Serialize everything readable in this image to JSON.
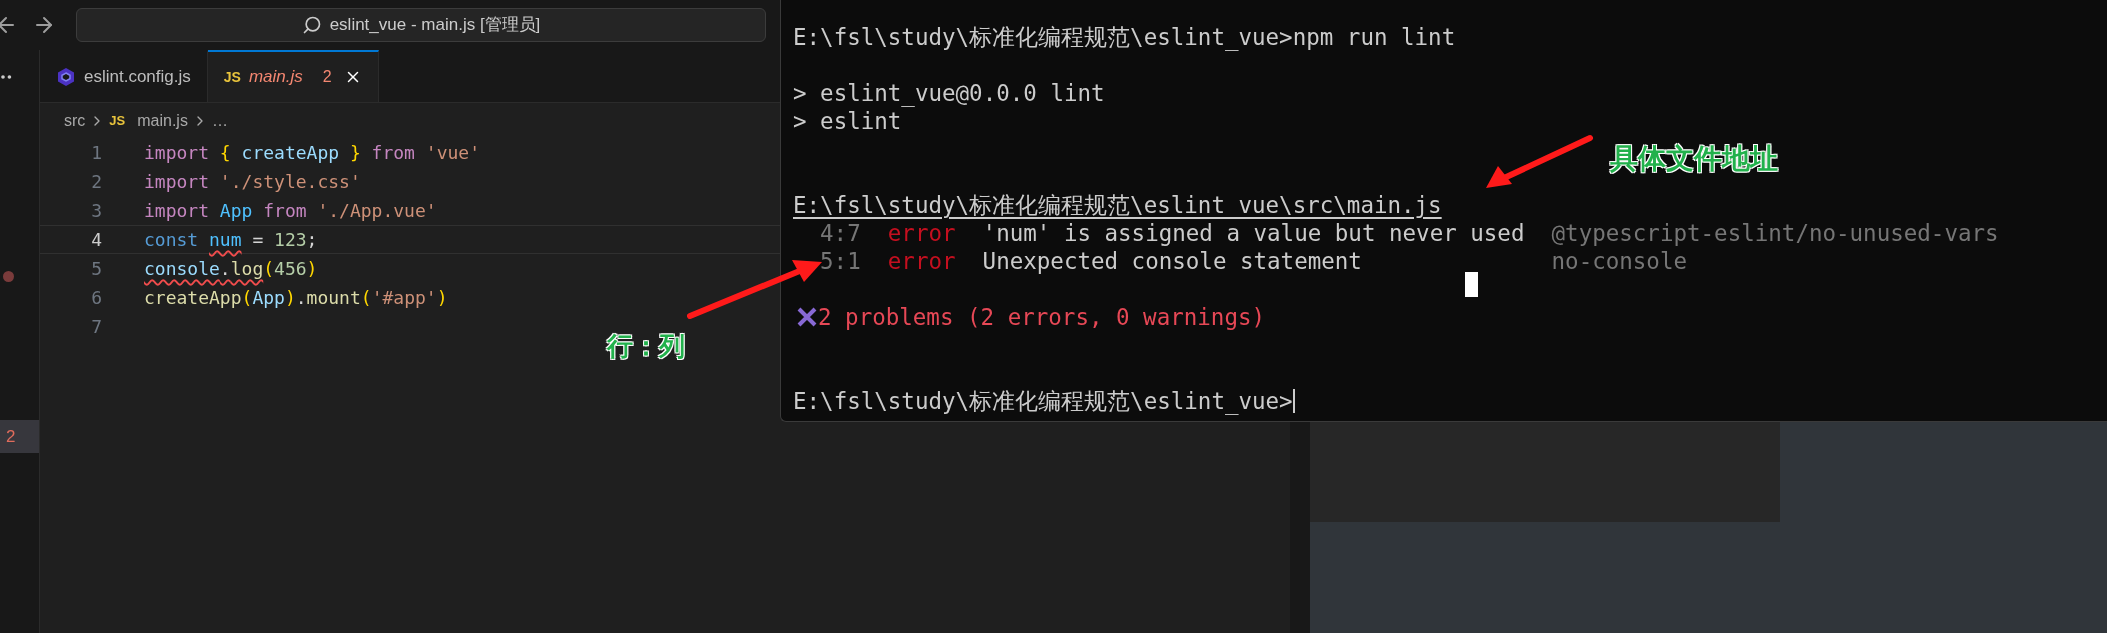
{
  "title_bar": {
    "search_text": "eslint_vue - main.js [管理员]"
  },
  "side_strip": {
    "badge": "2"
  },
  "tabs": [
    {
      "label": "eslint.config.js",
      "kind": "eslint",
      "selected": false,
      "error": false
    },
    {
      "label": "main.js",
      "kind": "js",
      "icon_text": "JS",
      "selected": true,
      "error": true,
      "problem_count": "2"
    }
  ],
  "breadcrumb": {
    "folder": "src",
    "file_icon": "JS",
    "file": "main.js",
    "more": "…"
  },
  "code_lines": [
    {
      "number": "1",
      "selected": false,
      "tokens": [
        {
          "text": "import ",
          "kind": "keyword",
          "squiggle": false
        },
        {
          "text": "{",
          "kind": "bracket",
          "squiggle": false
        },
        {
          "text": " createApp ",
          "kind": "variable",
          "squiggle": false
        },
        {
          "text": "}",
          "kind": "bracket",
          "squiggle": false
        },
        {
          "text": " from",
          "kind": "keyword",
          "squiggle": false
        },
        {
          "text": " 'vue'",
          "kind": "string",
          "squiggle": false
        }
      ]
    },
    {
      "number": "2",
      "selected": false,
      "tokens": [
        {
          "text": "import",
          "kind": "keyword",
          "squiggle": false
        },
        {
          "text": " './style.css'",
          "kind": "string",
          "squiggle": false
        }
      ]
    },
    {
      "number": "3",
      "selected": false,
      "tokens": [
        {
          "text": "import ",
          "kind": "keyword",
          "squiggle": false
        },
        {
          "text": "App",
          "kind": "constant",
          "squiggle": false
        },
        {
          "text": " from",
          "kind": "keyword",
          "squiggle": false
        },
        {
          "text": " './App.vue'",
          "kind": "string",
          "squiggle": false
        }
      ]
    },
    {
      "number": "4",
      "selected": true,
      "tokens": [
        {
          "text": "const ",
          "kind": "storage",
          "squiggle": false
        },
        {
          "text": "num",
          "kind": "constant",
          "squiggle": true
        },
        {
          "text": " = ",
          "kind": "plain",
          "squiggle": false
        },
        {
          "text": "123",
          "kind": "number",
          "squiggle": false
        },
        {
          "text": ";",
          "kind": "plain",
          "squiggle": false
        }
      ]
    },
    {
      "number": "5",
      "selected": false,
      "tokens": [
        {
          "text": "console",
          "kind": "variable",
          "squiggle": true
        },
        {
          "text": ".",
          "kind": "plain",
          "squiggle": true
        },
        {
          "text": "log",
          "kind": "function",
          "squiggle": true
        },
        {
          "text": "(",
          "kind": "bracket",
          "squiggle": false
        },
        {
          "text": "456",
          "kind": "number",
          "squiggle": false
        },
        {
          "text": ")",
          "kind": "bracket",
          "squiggle": false
        }
      ]
    },
    {
      "number": "6",
      "selected": false,
      "tokens": [
        {
          "text": "createApp",
          "kind": "function",
          "squiggle": false
        },
        {
          "text": "(",
          "kind": "bracket",
          "squiggle": false
        },
        {
          "text": "App",
          "kind": "variable",
          "squiggle": false
        },
        {
          "text": ")",
          "kind": "bracket",
          "squiggle": false
        },
        {
          "text": ".",
          "kind": "plain",
          "squiggle": false
        },
        {
          "text": "mount",
          "kind": "function",
          "squiggle": false
        },
        {
          "text": "(",
          "kind": "bracket",
          "squiggle": false
        },
        {
          "text": "'#app'",
          "kind": "string",
          "squiggle": false
        },
        {
          "text": ")",
          "kind": "bracket",
          "squiggle": false
        }
      ]
    },
    {
      "number": "7",
      "selected": false
    }
  ],
  "terminal_lines": [
    {
      "kind": "prompt",
      "text": "E:\\fsl\\study\\标准化编程规范\\eslint_vue>npm run lint",
      "cursor": false
    },
    {
      "kind": "blank"
    },
    {
      "kind": "output",
      "text": "> eslint_vue@0.0.0 lint"
    },
    {
      "kind": "output",
      "text": "> eslint"
    },
    {
      "kind": "blank"
    },
    {
      "kind": "blank"
    },
    {
      "kind": "path",
      "text": "E:\\fsl\\study\\标准化编程规范\\eslint_vue\\src\\main.js"
    },
    {
      "kind": "problem",
      "location": "4:7",
      "severity": "error",
      "message": "'num' is assigned a value but never used",
      "rule": "@typescript-eslint/no-unused-vars"
    },
    {
      "kind": "problem",
      "location": "5:1",
      "severity": "error",
      "message": "Unexpected console statement",
      "rule": "no-console"
    },
    {
      "kind": "blank"
    },
    {
      "kind": "summary",
      "text": "2 problems (2 errors, 0 warnings)"
    },
    {
      "kind": "blank"
    },
    {
      "kind": "blank"
    },
    {
      "kind": "prompt",
      "text": "E:\\fsl\\study\\标准化编程规范\\eslint_vue>",
      "cursor": true
    }
  ],
  "annotations": [
    {
      "text": "行：列"
    },
    {
      "text": "具体文件地址"
    }
  ]
}
